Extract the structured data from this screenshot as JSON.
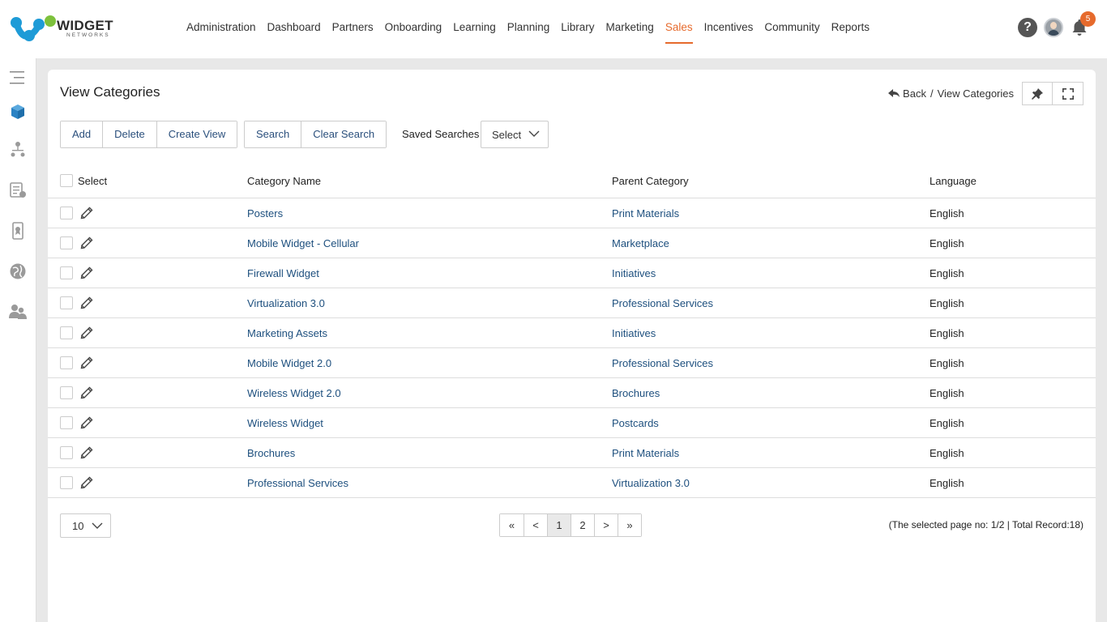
{
  "brand": {
    "name": "WIDGET",
    "sub": "NETWORKS"
  },
  "nav": [
    {
      "label": "Administration",
      "active": false
    },
    {
      "label": "Dashboard",
      "active": false
    },
    {
      "label": "Partners",
      "active": false
    },
    {
      "label": "Onboarding",
      "active": false
    },
    {
      "label": "Learning",
      "active": false
    },
    {
      "label": "Planning",
      "active": false
    },
    {
      "label": "Library",
      "active": false
    },
    {
      "label": "Marketing",
      "active": false
    },
    {
      "label": "Sales",
      "active": true
    },
    {
      "label": "Incentives",
      "active": false
    },
    {
      "label": "Community",
      "active": false
    },
    {
      "label": "Reports",
      "active": false
    }
  ],
  "notifications": {
    "count": "5"
  },
  "help": {
    "glyph": "?"
  },
  "colors": {
    "accent": "#e66a2c",
    "link": "#1d4f7e",
    "brand_blue": "#1e9bd7",
    "brand_green": "#7dc13c"
  },
  "page": {
    "title": "View Categories",
    "breadcrumb": {
      "back": "Back",
      "separator": "/",
      "current": "View Categories"
    }
  },
  "toolbar": {
    "group1": [
      "Add",
      "Delete",
      "Create View"
    ],
    "group2": [
      "Search",
      "Clear Search"
    ],
    "saved_searches_label": "Saved Searches",
    "saved_searches_value": "Select"
  },
  "table": {
    "headers": {
      "select": "Select",
      "name": "Category Name",
      "parent": "Parent Category",
      "language": "Language"
    },
    "rows": [
      {
        "name": "Posters",
        "parent": "Print Materials",
        "language": "English"
      },
      {
        "name": "Mobile Widget - Cellular",
        "parent": "Marketplace",
        "language": "English"
      },
      {
        "name": "Firewall Widget",
        "parent": "Initiatives",
        "language": "English"
      },
      {
        "name": "Virtualization 3.0",
        "parent": "Professional Services",
        "language": "English"
      },
      {
        "name": "Marketing Assets",
        "parent": "Initiatives",
        "language": "English"
      },
      {
        "name": "Mobile Widget 2.0",
        "parent": "Professional Services",
        "language": "English"
      },
      {
        "name": "Wireless Widget 2.0",
        "parent": "Brochures",
        "language": "English"
      },
      {
        "name": "Wireless Widget",
        "parent": "Postcards",
        "language": "English"
      },
      {
        "name": "Brochures",
        "parent": "Print Materials",
        "language": "English"
      },
      {
        "name": "Professional Services",
        "parent": "Virtualization 3.0",
        "language": "English"
      }
    ]
  },
  "footer": {
    "page_size": "10",
    "pager": [
      {
        "label": "«",
        "active": false
      },
      {
        "label": "<",
        "active": false
      },
      {
        "label": "1",
        "active": true
      },
      {
        "label": "2",
        "active": false
      },
      {
        "label": ">",
        "active": false
      },
      {
        "label": "»",
        "active": false
      }
    ],
    "record_info": "(The selected page no: 1/2 | Total Record:18)"
  }
}
